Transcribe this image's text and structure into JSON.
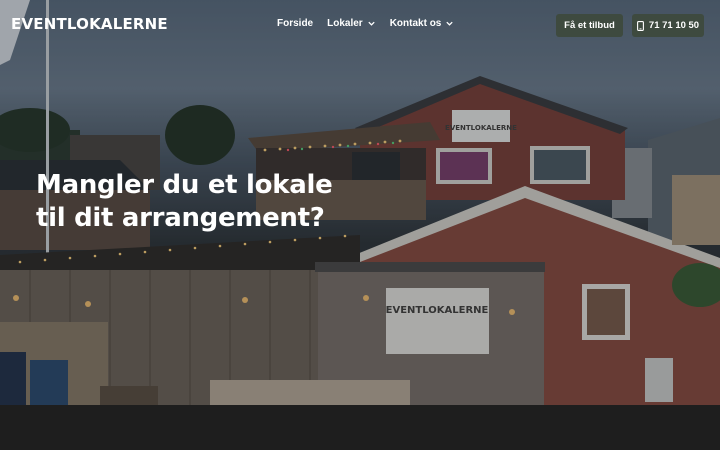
{
  "header": {
    "logo_text": "EVENTLOKALERNE",
    "nav": [
      {
        "label": "Forside",
        "dropdown": false
      },
      {
        "label": "Lokaler",
        "dropdown": true
      },
      {
        "label": "Kontakt os",
        "dropdown": true
      }
    ],
    "cta_label": "Få et tilbud",
    "phone_label": "71 71 10 50"
  },
  "hero": {
    "headline_line1": "Mangler du et lokale",
    "headline_line2": "til dit arrangement?",
    "sign_large": "EVENTLOKALERNE",
    "sign_small": "EVENTLOKALERNE"
  },
  "colors": {
    "button_bg": "#3e4a3f",
    "text": "#ffffff",
    "footer_bg": "#1e1e1e"
  }
}
